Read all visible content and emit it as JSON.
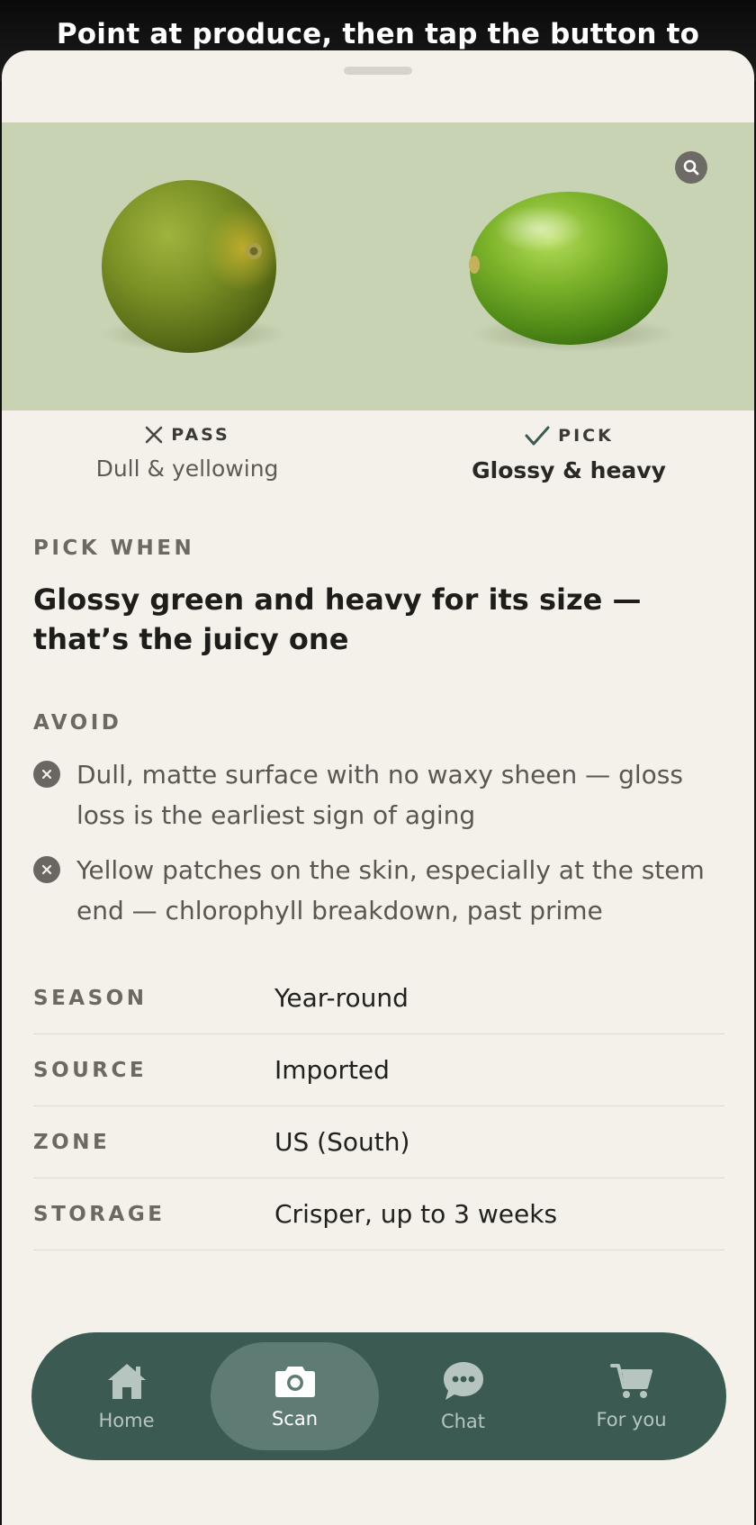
{
  "header": {
    "instruction": "Point at produce, then tap the button to"
  },
  "comparison": {
    "pass": {
      "tag": "PASS",
      "description": "Dull & yellowing"
    },
    "pick": {
      "tag": "PICK",
      "description": "Glossy & heavy"
    }
  },
  "pick_when": {
    "label": "PICK WHEN",
    "text": "Glossy green and heavy for its size — that’s the juicy one"
  },
  "avoid": {
    "label": "AVOID",
    "items": [
      "Dull, matte surface with no waxy sheen — gloss loss is the earliest sign of aging",
      "Yellow patches on the skin, especially at the stem end — chlorophyll breakdown, past prime"
    ]
  },
  "facts": [
    {
      "key": "SEASON",
      "value": "Year-round"
    },
    {
      "key": "SOURCE",
      "value": "Imported"
    },
    {
      "key": "ZONE",
      "value": "US (South)"
    },
    {
      "key": "STORAGE",
      "value": "Crisper, up to 3 weeks"
    }
  ],
  "nav": {
    "items": [
      {
        "label": "Home",
        "icon": "home-icon",
        "active": false
      },
      {
        "label": "Scan",
        "icon": "camera-icon",
        "active": true
      },
      {
        "label": "Chat",
        "icon": "chat-icon",
        "active": false
      },
      {
        "label": "For you",
        "icon": "cart-icon",
        "active": false
      }
    ]
  },
  "colors": {
    "sheet_bg": "#f3f1ea",
    "hero_bg": "#c8d3b3",
    "nav_bg": "#3b5a52",
    "nav_active": "#5f7c74",
    "accent_check": "#3b5a52"
  }
}
